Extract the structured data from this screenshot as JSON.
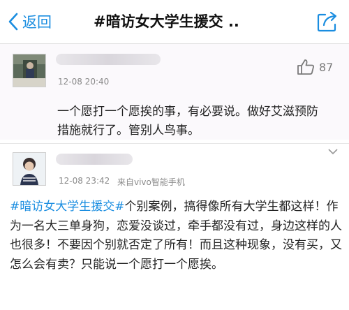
{
  "header": {
    "back_label": "返回",
    "title": "#暗访女大学生援交 .."
  },
  "comments": [
    {
      "time": "12-08 20:40",
      "likes": "87",
      "text": "一个愿打一个愿挨的事，有必要说。做好艾滋预防措施就行了。管别人鸟事。"
    },
    {
      "time": "12-08 23:42",
      "source": "来自vivo智能手机",
      "hashtag": "#暗访女大学生援交#",
      "text": "个别案例，搞得像所有大学生都这样！作为一名大三单身狗，恋爱没谈过，牵手都没有过，身边这样的人也很多！不要因个别就否定了所有！而且这种现象，没有买，又怎么会有卖？只能说一个愿打一个愿挨。"
    }
  ],
  "colors": {
    "accent": "#1a8de0",
    "muted": "#8a8a8a"
  },
  "icons": [
    "chevron-left-icon",
    "share-icon",
    "thumbs-up-icon",
    "chevron-down-icon"
  ]
}
